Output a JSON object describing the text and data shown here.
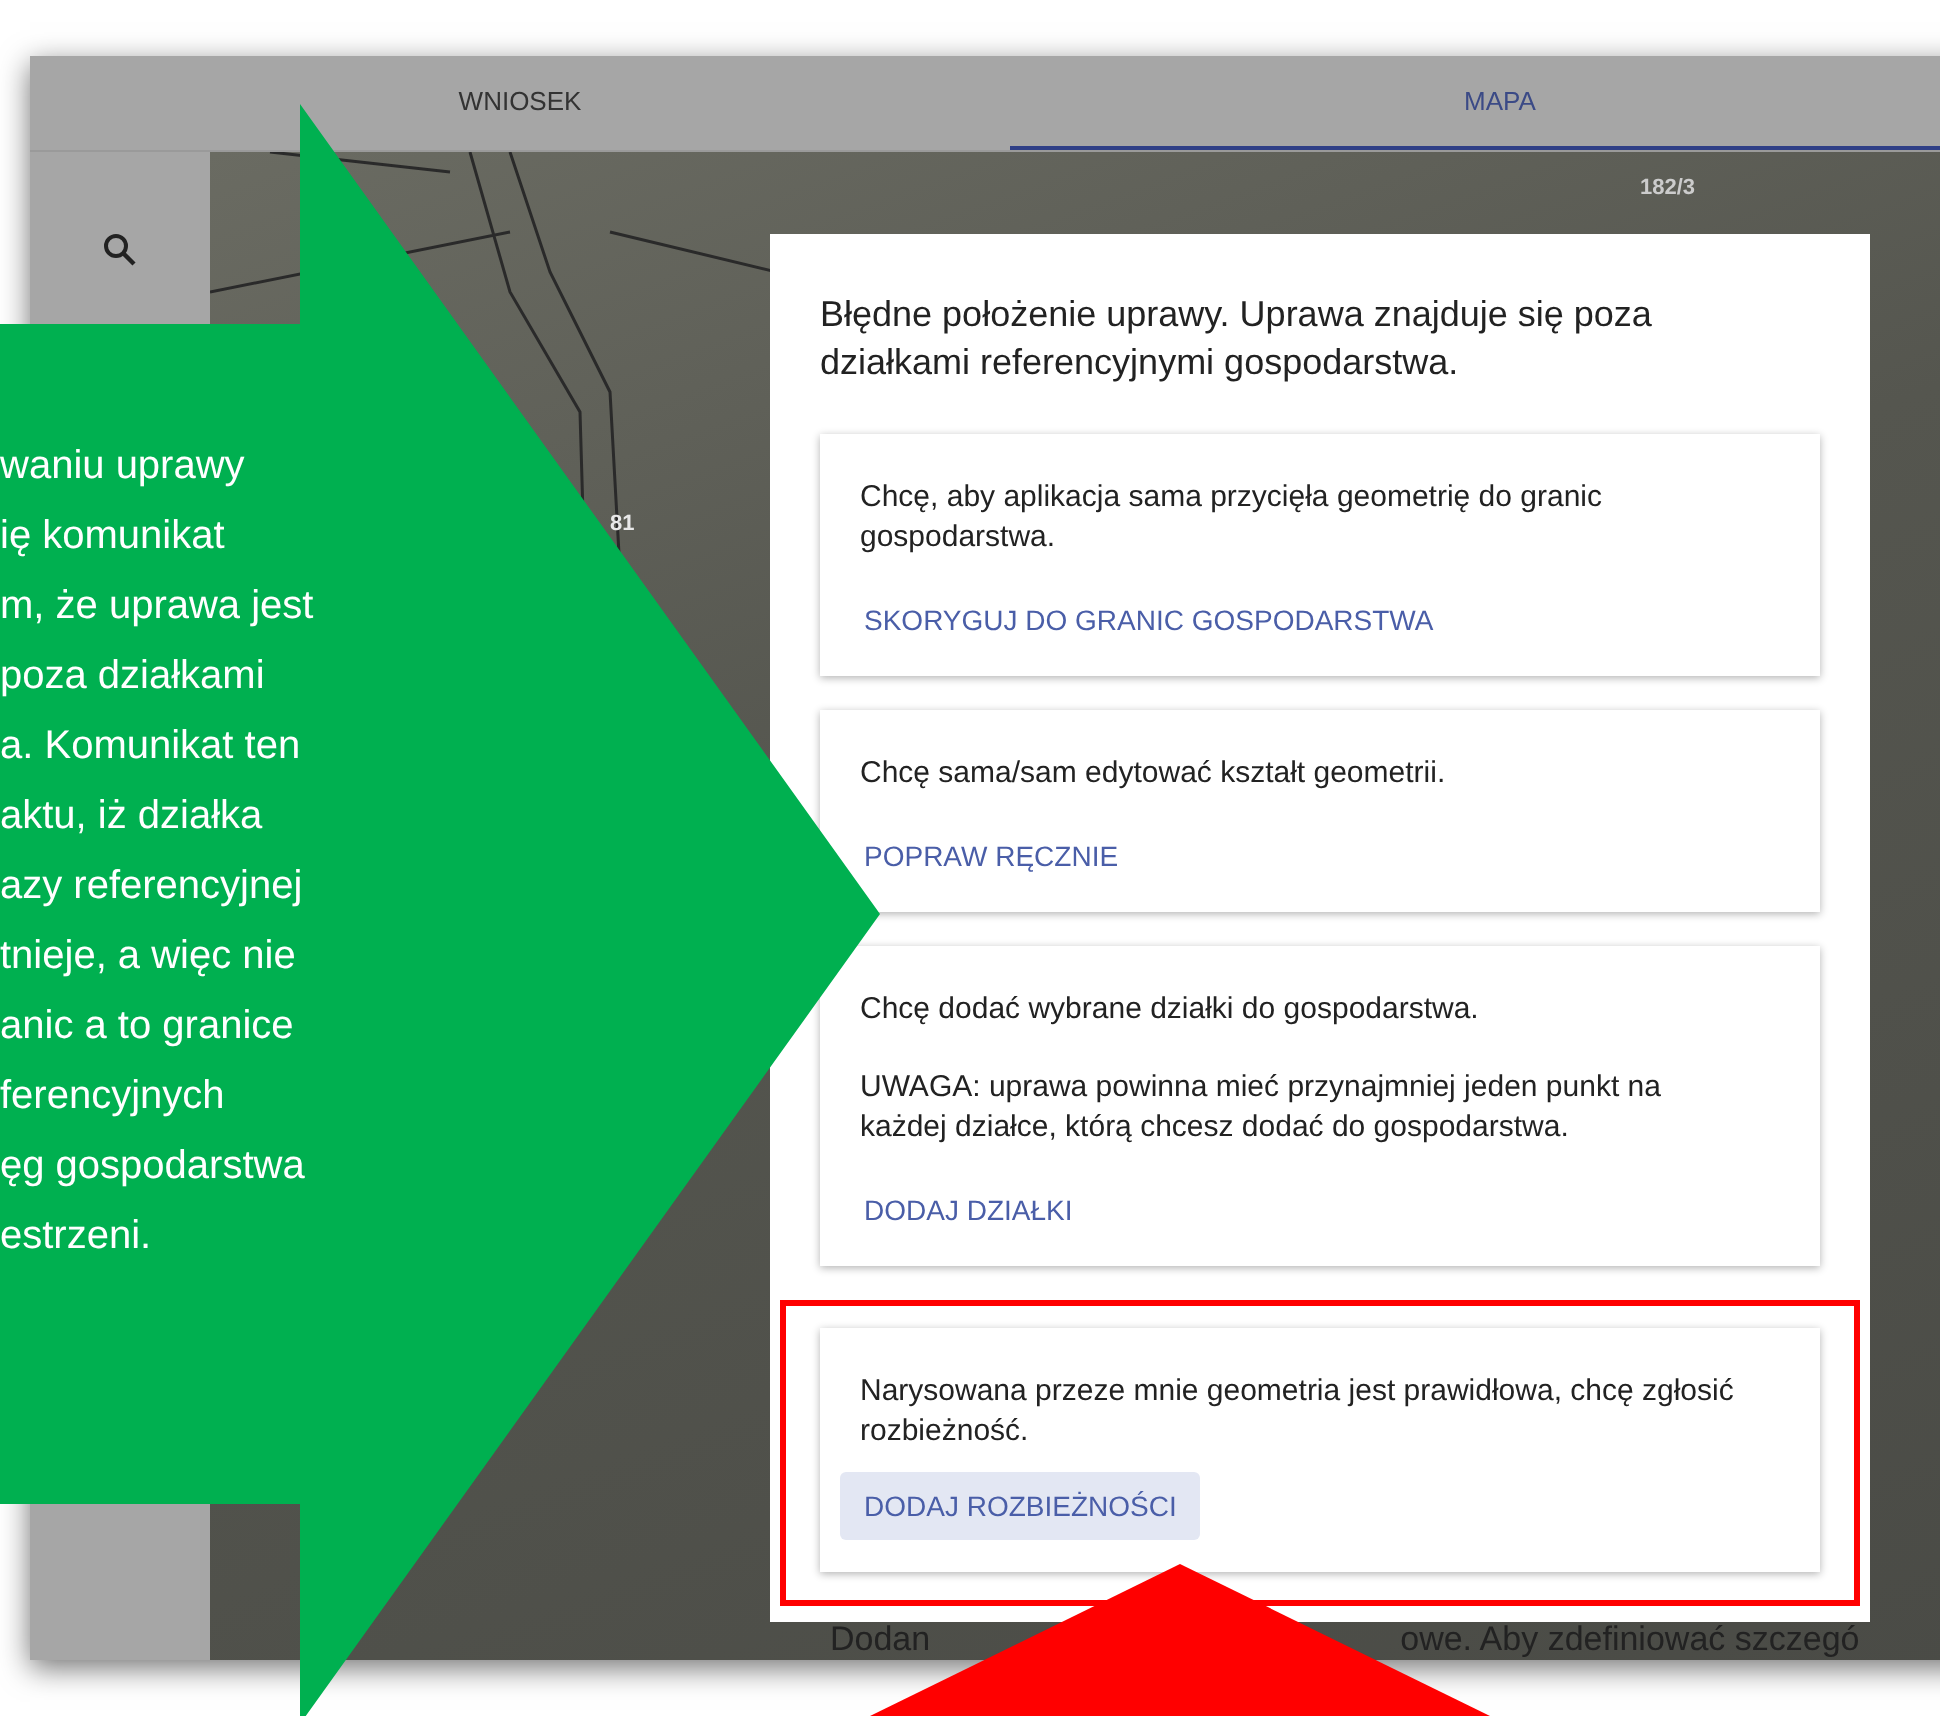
{
  "tabs": [
    {
      "label": "WNIOSEK",
      "selected": false
    },
    {
      "label": "MAPA",
      "selected": true
    }
  ],
  "map": {
    "parcel_labels": [
      "182/3",
      "81"
    ],
    "bottom_text": [
      "Dodan",
      "owe. Aby zdefiniować szczegó"
    ]
  },
  "dialog": {
    "title": "Błędne położenie uprawy. Uprawa znajduje się poza działkami referencyjnymi gospodarstwa.",
    "options": [
      {
        "paragraphs": [
          "Chcę, aby aplikacja sama przycięła geometrię do granic gospodarstwa."
        ],
        "button": {
          "label": "SKORYGUJ DO GRANIC GOSPODARSTWA",
          "focused": false
        },
        "annotated": false
      },
      {
        "paragraphs": [
          "Chcę sama/sam edytować kształt geometrii."
        ],
        "button": {
          "label": "POPRAW RĘCZNIE",
          "focused": false
        },
        "annotated": false
      },
      {
        "paragraphs": [
          "Chcę dodać wybrane działki do gospodarstwa.",
          "UWAGA: uprawa powinna mieć przynajmniej jeden punkt na każdej działce, którą chcesz dodać do gospodarstwa."
        ],
        "button": {
          "label": "DODAJ DZIAŁKI",
          "focused": false
        },
        "annotated": false
      },
      {
        "paragraphs": [
          "Narysowana przeze mnie geometria jest prawidłowa, chcę zgłosić rozbieżność."
        ],
        "button": {
          "label": "DODAJ ROZBIEŻNOŚCI",
          "focused": true
        },
        "annotated": true
      }
    ]
  },
  "callout": {
    "lines": [
      "waniu uprawy",
      "ię komunikat",
      "m, że uprawa jest",
      "poza działkami",
      "a. Komunikat ten",
      "aktu, iż działka",
      "azy referencyjnej",
      "tnieje, a więc nie",
      "anic a to granice",
      "ferencyjnych",
      "ęg gospodarstwa",
      "estrzeni."
    ]
  }
}
